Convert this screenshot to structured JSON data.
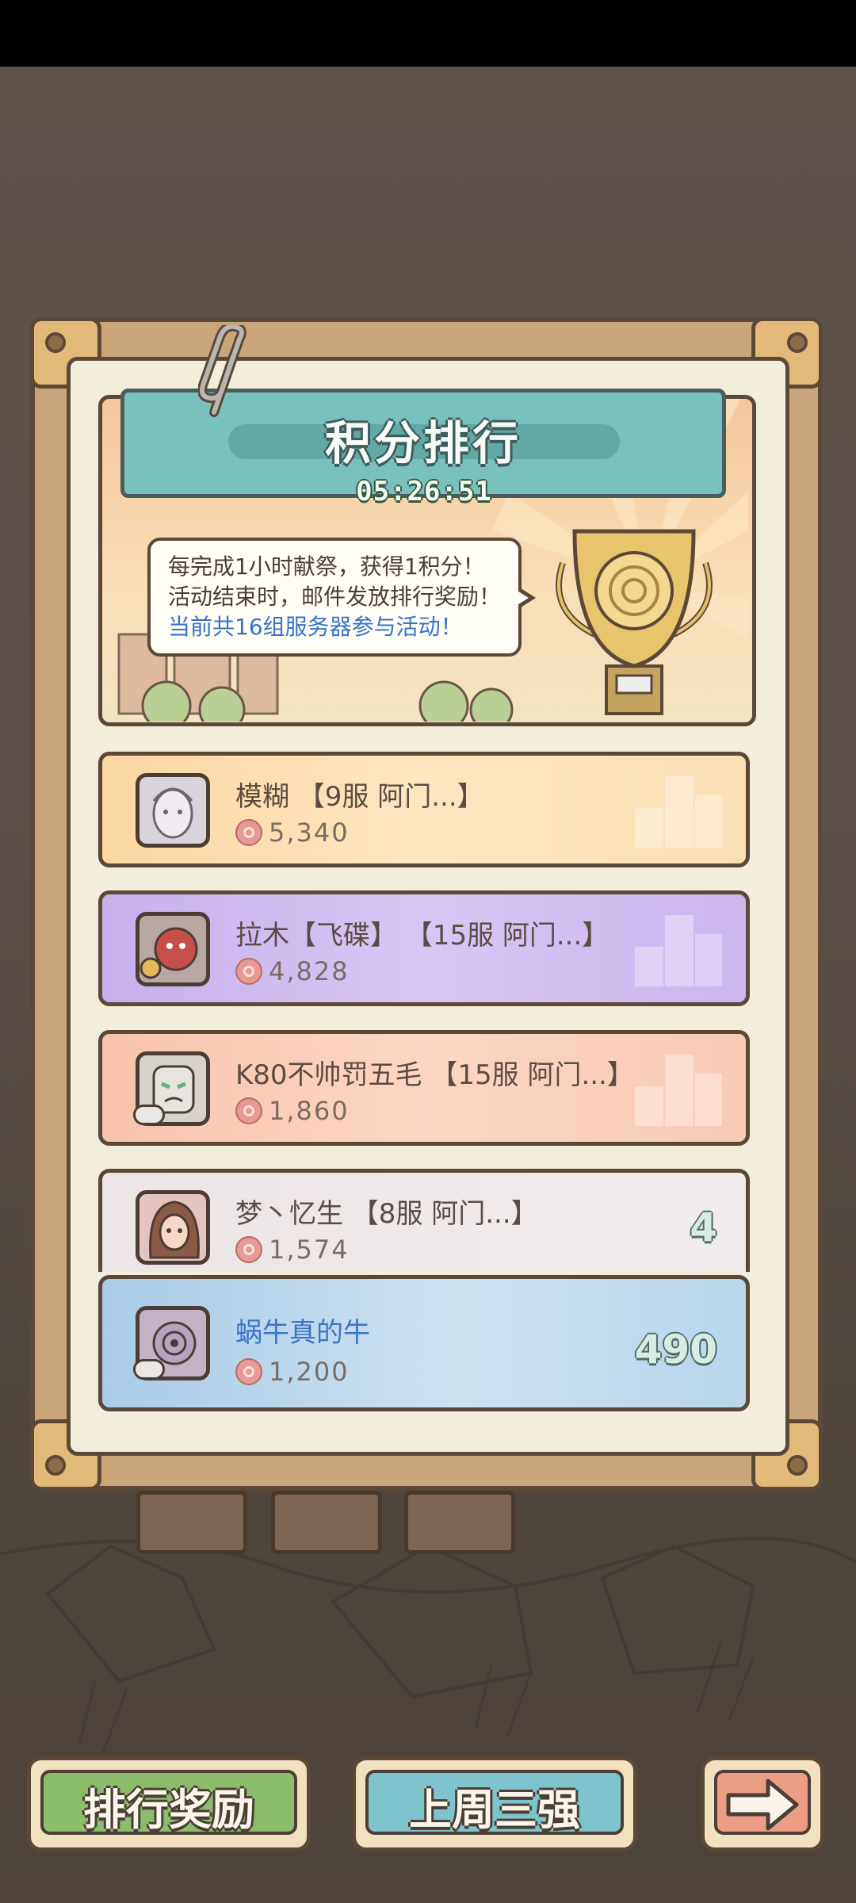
{
  "panel": {
    "title": "积分排行",
    "timer": "05:26:51",
    "info_line1": "每完成1小时献祭，获得1积分！",
    "info_line2": "活动结束时，邮件发放排行奖励！",
    "info_line3": "当前共16组服务器参与活动！"
  },
  "ranking": [
    {
      "name": "模糊 【9服 阿门...】",
      "score": "5,340",
      "tier": "gold"
    },
    {
      "name": "拉木【飞碟】 【15服 阿门...】",
      "score": "4,828",
      "tier": "purple"
    },
    {
      "name": "K80不帅罚五毛 【15服 阿门...】",
      "score": "1,860",
      "tier": "orange"
    },
    {
      "name": "梦丶忆生 【8服 阿门...】",
      "score": "1,574",
      "rank": "4"
    }
  ],
  "me": {
    "name": "蜗牛真的牛",
    "score": "1,200",
    "rank": "490"
  },
  "buttons": {
    "reward": "排行奖励",
    "top3": "上周三强",
    "next_icon": "arrow-right-icon"
  },
  "colors": {
    "banner": "#79c1bd",
    "self_name": "#3b74c8",
    "reward_button": "#8bbd6c",
    "top3_button": "#7fc3cd",
    "next_button": "#ec9e85"
  }
}
